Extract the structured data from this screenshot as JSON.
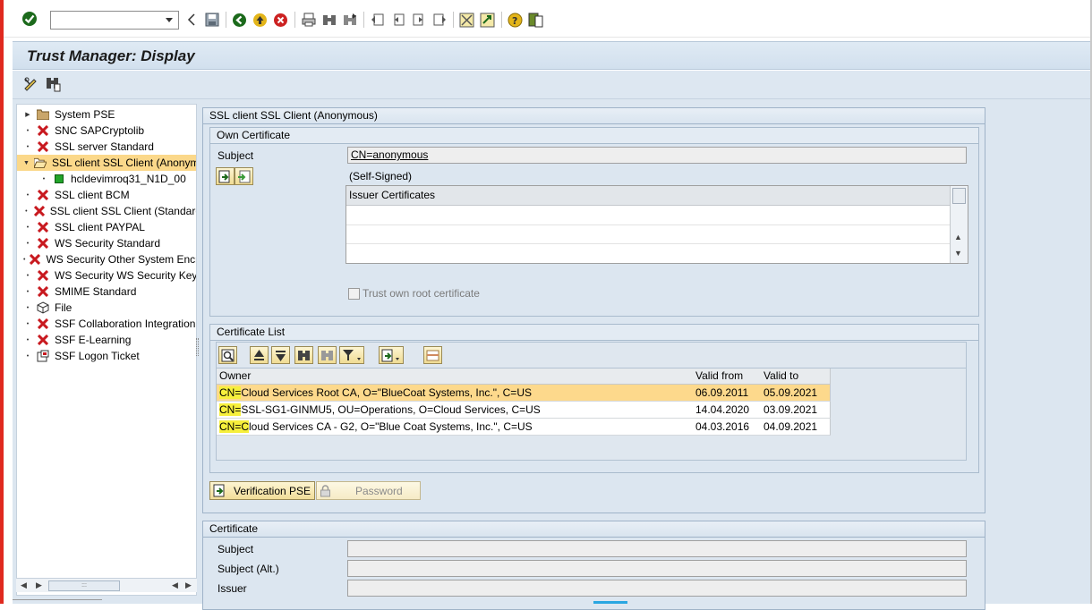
{
  "toolbar": {
    "command_value": "",
    "icons": [
      "enter-icon",
      "back-icon",
      "save-icon",
      "back-green-icon",
      "exit-icon",
      "cancel-icon",
      "print-icon",
      "find-icon",
      "find-next-icon",
      "first-page-icon",
      "prev-page-icon",
      "next-page-icon",
      "last-page-icon",
      "create-session-icon",
      "shortcut-icon",
      "help-icon",
      "layout-icon"
    ]
  },
  "title": "Trust Manager: Display",
  "app_toolbar": {
    "icons": [
      "display-change-icon",
      "where-used-icon"
    ]
  },
  "tree": {
    "items": [
      {
        "label": "System PSE",
        "icon": "folder-icon",
        "expandable": true
      },
      {
        "label": "SNC SAPCryptolib",
        "icon": "error-x-icon"
      },
      {
        "label": "SSL server Standard",
        "icon": "error-x-icon"
      },
      {
        "label": "SSL client SSL Client (Anonymous)",
        "icon": "folder-open-icon",
        "expanded": true,
        "selected": true
      },
      {
        "label": "hcldevimroq31_N1D_00",
        "icon": "green-square-icon",
        "child": true
      },
      {
        "label": "SSL client BCM",
        "icon": "error-x-icon"
      },
      {
        "label": "SSL client SSL Client (Standard)",
        "icon": "error-x-icon"
      },
      {
        "label": "SSL client PAYPAL",
        "icon": "error-x-icon"
      },
      {
        "label": "WS Security Standard",
        "icon": "error-x-icon"
      },
      {
        "label": "WS Security Other System Encryption",
        "icon": "error-x-icon"
      },
      {
        "label": "WS Security WS Security Keys",
        "icon": "error-x-icon"
      },
      {
        "label": "SMIME Standard",
        "icon": "error-x-icon"
      },
      {
        "label": "File",
        "icon": "cube-icon"
      },
      {
        "label": "SSF Collaboration Integration",
        "icon": "error-x-icon"
      },
      {
        "label": "SSF E-Learning",
        "icon": "error-x-icon"
      },
      {
        "label": "SSF Logon Ticket",
        "icon": "certificate-icon"
      }
    ]
  },
  "pse_panel": {
    "header": "SSL client SSL Client (Anonymous)",
    "own_certificate": {
      "header": "Own Certificate",
      "subject_label": "Subject",
      "subject_value": "CN=anonymous",
      "self_signed": "(Self-Signed)",
      "issuer_header": "Issuer Certificates",
      "trust_label": "Trust own root certificate"
    },
    "cert_list": {
      "header": "Certificate List",
      "columns": [
        "Owner",
        "Valid from",
        "Valid to"
      ],
      "rows": [
        {
          "owner_prefix": "CN=",
          "owner_rest": "Cloud Services Root CA, O=\"BlueCoat Systems, Inc.\", C=US",
          "valid_from": "06.09.2011",
          "valid_to": "05.09.2021",
          "selected": true
        },
        {
          "owner_prefix": "CN=",
          "owner_rest": "SSL-SG1-GINMU5, OU=Operations, O=Cloud Services, C=US",
          "valid_from": "14.04.2020",
          "valid_to": "03.09.2021"
        },
        {
          "owner_prefix": "CN=C",
          "owner_rest": "loud Services CA - G2, O=\"Blue Coat Systems, Inc.\", C=US",
          "valid_from": "04.03.2016",
          "valid_to": "04.09.2021"
        }
      ]
    },
    "verification_btn": "Verification PSE",
    "password_btn": "Password"
  },
  "certificate_panel": {
    "header": "Certificate",
    "subject_label": "Subject",
    "subject_alt_label": "Subject (Alt.)",
    "issuer_label": "Issuer"
  }
}
